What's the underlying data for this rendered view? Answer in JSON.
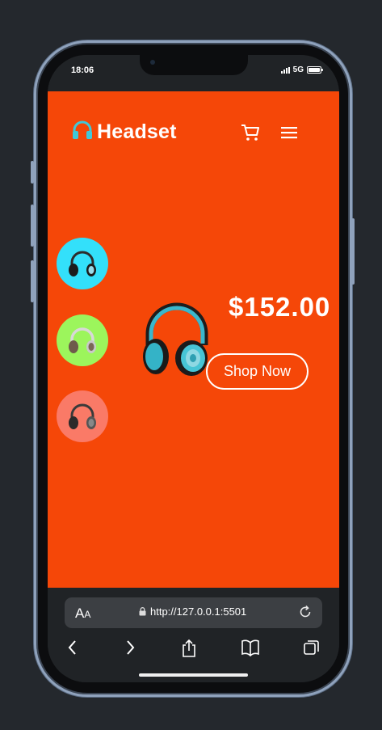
{
  "status_bar": {
    "time": "18:06",
    "network": "5G",
    "battery_percent": 100
  },
  "app": {
    "brand": "Headset",
    "background_color": "#f54708",
    "thumbnails": [
      {
        "name": "headset-blue",
        "color": "#33e0fa"
      },
      {
        "name": "headset-green",
        "color": "#9cf55c"
      },
      {
        "name": "headset-pink",
        "color": "#fa7a67"
      }
    ],
    "price": "$152.00",
    "cta_label": "Shop Now",
    "icons": [
      "headphones-icon",
      "cart-icon",
      "menu-icon"
    ]
  },
  "browser": {
    "text_size_label_large": "A",
    "text_size_label_small": "A",
    "url": "http://127.0.0.1:5501",
    "icons": [
      "lock-icon",
      "reload-icon",
      "back-icon",
      "forward-icon",
      "share-icon",
      "bookmarks-icon",
      "tabs-icon"
    ]
  }
}
